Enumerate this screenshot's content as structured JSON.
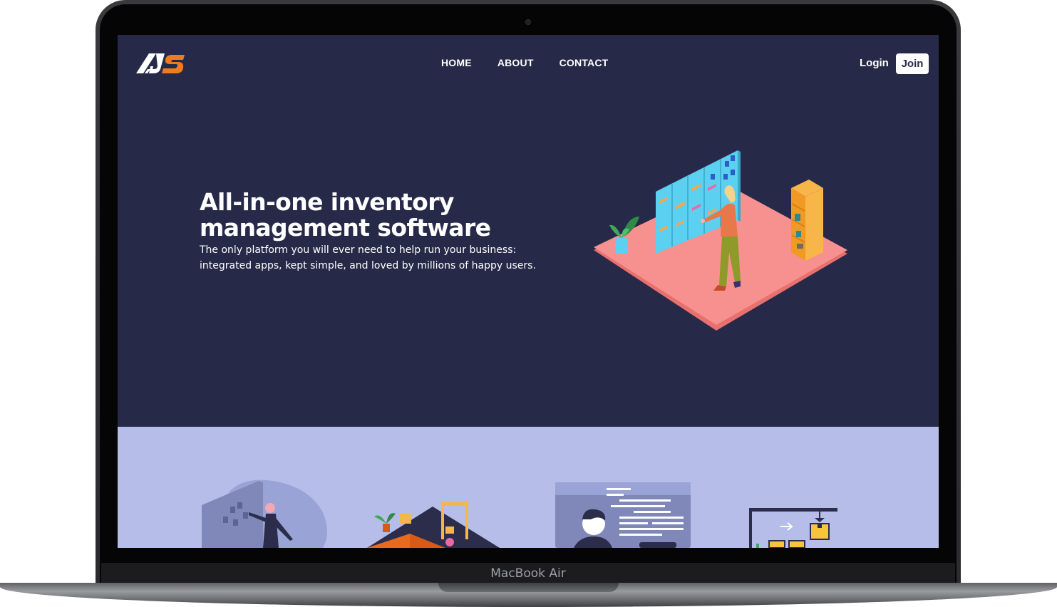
{
  "device": {
    "label": "MacBook Air"
  },
  "site": {
    "logo_text": "JS",
    "nav": [
      {
        "label": "HOME"
      },
      {
        "label": "ABOUT"
      },
      {
        "label": "CONTACT"
      }
    ],
    "login_label": "Login",
    "join_label": "Join"
  },
  "hero": {
    "title": "All-in-one inventory management software",
    "subtitle": "The only platform you will ever need to help run your business: integrated apps, kept simple, and loved by millions of happy users."
  },
  "colors": {
    "hero_background": "#262a48",
    "features_background": "#b6bde9",
    "accent_orange": "#f07b1f",
    "floor_pink": "#f7918f",
    "board_cyan": "#5cd0f0"
  },
  "icons": [
    "logo-icon",
    "inventory-board-illustration",
    "analytics-wall-illustration",
    "warehouse-illustration",
    "developer-screen-illustration",
    "crane-boxes-illustration"
  ]
}
